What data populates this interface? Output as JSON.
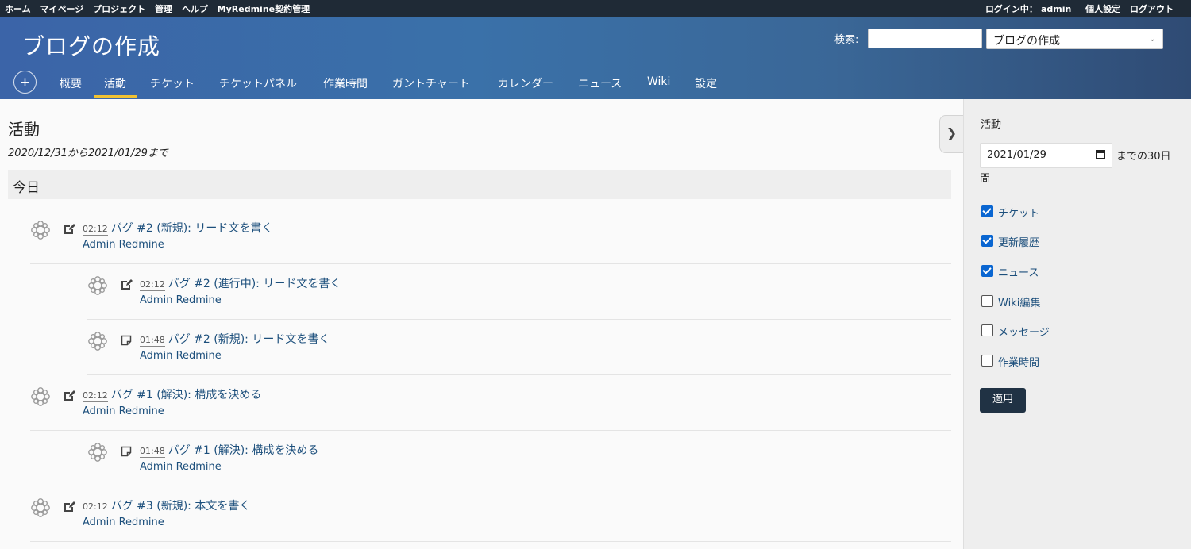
{
  "top_menu": {
    "left": [
      "ホーム",
      "マイページ",
      "プロジェクト",
      "管理",
      "ヘルプ",
      "MyRedmine契約管理"
    ],
    "logged_in_label": "ログイン中：",
    "user": "admin",
    "my_account": "個人設定",
    "logout": "ログアウト"
  },
  "header": {
    "project_title": "ブログの作成",
    "search_label": "検索:",
    "search_value": "",
    "project_select": "ブログの作成"
  },
  "main_menu": {
    "new_object": "+",
    "tabs": [
      "概要",
      "活動",
      "チケット",
      "チケットパネル",
      "作業時間",
      "ガントチャート",
      "カレンダー",
      "ニュース",
      "Wiki",
      "設定"
    ],
    "selected": "活動"
  },
  "content": {
    "title": "活動",
    "date_range": "2020/12/31から2021/01/29まで",
    "day": "今日",
    "entries": [
      {
        "time": "02:12",
        "text": "バグ #2 (新規): リード文を書く",
        "author": "Admin Redmine",
        "icon": "edit-icon"
      },
      {
        "time": "02:12",
        "text": "バグ #2 (進行中): リード文を書く",
        "author": "Admin Redmine",
        "icon": "edit-icon"
      },
      {
        "time": "01:48",
        "text": "バグ #2 (新規): リード文を書く",
        "author": "Admin Redmine",
        "icon": "note-icon"
      },
      {
        "time": "02:12",
        "text": "バグ #1 (解決): 構成を決める",
        "author": "Admin Redmine",
        "icon": "edit-icon"
      },
      {
        "time": "01:48",
        "text": "バグ #1 (解決): 構成を決める",
        "author": "Admin Redmine",
        "icon": "note-icon"
      },
      {
        "time": "02:12",
        "text": "バグ #3 (新規): 本文を書く",
        "author": "Admin Redmine",
        "icon": "edit-icon"
      }
    ]
  },
  "sidebar": {
    "title": "活動",
    "date": "2021/01/29",
    "days_suffix_1": "までの30日",
    "days_suffix_2": "間",
    "filters": [
      {
        "label": "チケット",
        "checked": true
      },
      {
        "label": "更新履歴",
        "checked": true
      },
      {
        "label": "ニュース",
        "checked": true
      },
      {
        "label": "Wiki編集",
        "checked": false
      },
      {
        "label": "メッセージ",
        "checked": false
      },
      {
        "label": "作業時間",
        "checked": false
      }
    ],
    "apply": "適用"
  },
  "colors": {
    "link": "#1c4f7c",
    "top_bar": "#1f2a36",
    "header": "#3a6da4",
    "selected_tab": "#f1c232",
    "apply_button": "#203244"
  }
}
